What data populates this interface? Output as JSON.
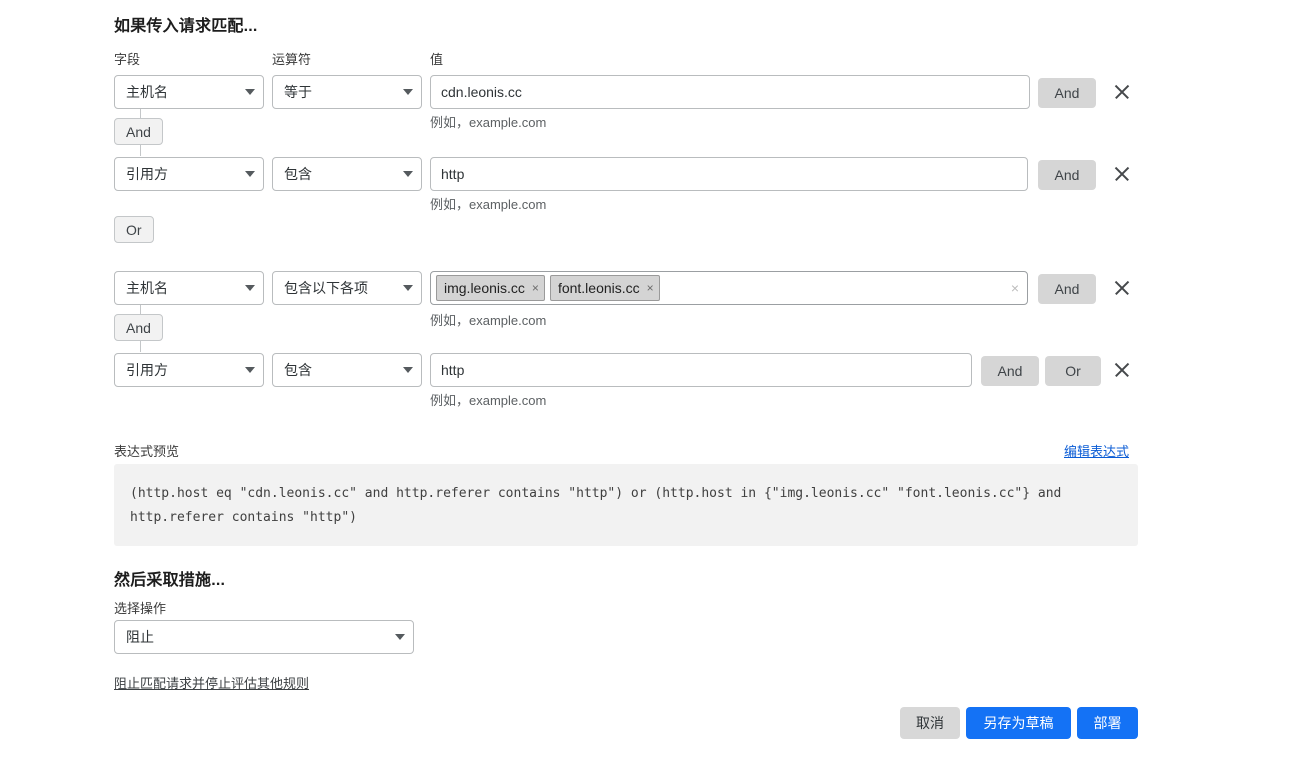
{
  "sections": {
    "match_title": "如果传入请求匹配...",
    "action_title": "然后采取措施..."
  },
  "column_headers": {
    "field": "字段",
    "operator": "运算符",
    "value": "值"
  },
  "helper_text": "例如，example.com",
  "rules": [
    {
      "field": "主机名",
      "operator": "等于",
      "value": "cdn.leonis.cc",
      "value_type": "text",
      "helper": "例如，example.com",
      "logic_buttons": [
        "And"
      ],
      "delete_label": "×"
    },
    {
      "field": "引用方",
      "operator": "包含",
      "value": "http",
      "value_type": "text",
      "helper": "例如，example.com",
      "logic_buttons": [
        "And"
      ],
      "delete_label": "×"
    },
    {
      "field": "主机名",
      "operator": "包含以下各项",
      "value": "",
      "value_type": "chips",
      "chips": [
        "img.leonis.cc",
        "font.leonis.cc"
      ],
      "clear_icon": "×",
      "helper": "例如，example.com",
      "logic_buttons": [
        "And"
      ],
      "delete_label": "×"
    },
    {
      "field": "引用方",
      "operator": "包含",
      "value": "http",
      "value_type": "text",
      "helper": "例如，example.com",
      "logic_buttons": [
        "And",
        "Or"
      ],
      "delete_label": "×"
    }
  ],
  "connectors": [
    {
      "label": "And"
    },
    {
      "label": "Or"
    },
    {
      "label": "And"
    }
  ],
  "expression": {
    "label": "表达式预览",
    "edit_link": "编辑表达式",
    "text": "(http.host eq \"cdn.leonis.cc\" and http.referer contains \"http\") or (http.host in {\"img.leonis.cc\" \"font.leonis.cc\"} and http.referer contains \"http\")"
  },
  "action": {
    "select_label": "选择操作",
    "selected": "阻止",
    "description": "阻止匹配请求并停止评估其他规则"
  },
  "footer": {
    "cancel": "取消",
    "save_draft": "另存为草稿",
    "deploy": "部署"
  },
  "colors": {
    "primary": "#1472f5",
    "link": "#0b5cd5",
    "logic_button_bg": "#d6d6d6",
    "expression_bg": "#f2f2f2",
    "chip_bg": "#d4d4d4"
  }
}
